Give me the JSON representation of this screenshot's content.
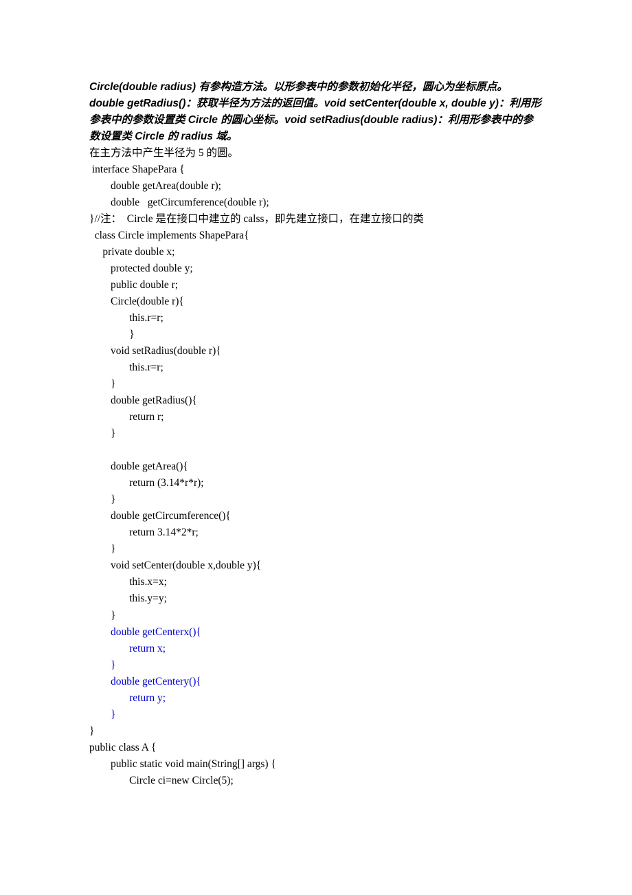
{
  "header_bold_italic": "Circle(double radius) 有参构造方法。以形参表中的参数初始化半径，圆心为坐标原点。 double getRadius()：获取半径为方法的返回值。void setCenter(double x, double y)：利用形参表中的参数设置类 Circle 的圆心坐标。void setRadius(double radius)：利用形参表中的参数设置类 Circle 的 radius 域。",
  "normal_line": "在主方法中产生半径为 5 的圆。",
  "code_lines": [
    {
      "text": " interface ShapePara {",
      "blue": false
    },
    {
      "text": "        double getArea(double r);",
      "blue": false
    },
    {
      "text": "        double   getCircumference(double r);",
      "blue": false
    },
    {
      "text": "}//注：  Circle 是在接口中建立的 calss，即先建立接口，在建立接口的类",
      "blue": false
    },
    {
      "text": "  class Circle implements ShapePara{",
      "blue": false
    },
    {
      "text": "     private double x;",
      "blue": false
    },
    {
      "text": "        protected double y;",
      "blue": false
    },
    {
      "text": "        public double r;",
      "blue": false
    },
    {
      "text": "        Circle(double r){",
      "blue": false
    },
    {
      "text": "               this.r=r;",
      "blue": false
    },
    {
      "text": "               }",
      "blue": false
    },
    {
      "text": "        void setRadius(double r){",
      "blue": false
    },
    {
      "text": "               this.r=r;",
      "blue": false
    },
    {
      "text": "        }",
      "blue": false
    },
    {
      "text": "        double getRadius(){",
      "blue": false
    },
    {
      "text": "               return r;",
      "blue": false
    },
    {
      "text": "        }",
      "blue": false
    },
    {
      "text": "",
      "blue": false
    },
    {
      "text": "        double getArea(){",
      "blue": false
    },
    {
      "text": "               return (3.14*r*r);",
      "blue": false
    },
    {
      "text": "        }",
      "blue": false
    },
    {
      "text": "        double getCircumference(){",
      "blue": false
    },
    {
      "text": "               return 3.14*2*r;",
      "blue": false
    },
    {
      "text": "        }",
      "blue": false
    },
    {
      "text": "        void setCenter(double x,double y){",
      "blue": false
    },
    {
      "text": "               this.x=x;",
      "blue": false
    },
    {
      "text": "               this.y=y;",
      "blue": false
    },
    {
      "text": "        }",
      "blue": false
    },
    {
      "text": "        double getCenterx(){",
      "blue": true
    },
    {
      "text": "               return x;",
      "blue": true
    },
    {
      "text": "        }",
      "blue": true
    },
    {
      "text": "        double getCentery(){",
      "blue": true
    },
    {
      "text": "               return y;",
      "blue": true
    },
    {
      "text": "        }",
      "blue": true
    },
    {
      "text": "}",
      "blue": false
    },
    {
      "text": "public class A {",
      "blue": false
    },
    {
      "text": "        public static void main(String[] args) {",
      "blue": false
    },
    {
      "text": "               Circle ci=new Circle(5);",
      "blue": false
    }
  ]
}
